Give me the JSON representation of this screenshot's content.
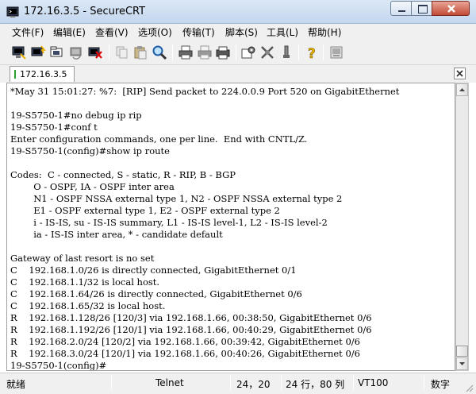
{
  "window": {
    "title": "172.16.3.5 - SecureCRT",
    "controls": [
      "minimize-icon",
      "maximize-icon",
      "close-icon"
    ]
  },
  "menu": {
    "items": [
      "文件(F)",
      "编辑(E)",
      "查看(V)",
      "选项(O)",
      "传输(T)",
      "脚本(S)",
      "工具(L)",
      "帮助(H)"
    ]
  },
  "toolbar": {
    "icons": [
      "connect-icon",
      "quick-connect-icon",
      "connect-tab-icon",
      "reconnect-icon",
      "disconnect-icon",
      "copy-icon",
      "paste-icon",
      "find-icon",
      "print-icon",
      "print-setup-icon",
      "print-screen-icon",
      "session-options-icon",
      "global-options-icon",
      "keymap-icon",
      "help-icon",
      "sftp-icon"
    ]
  },
  "tabs": [
    {
      "label": "172.16.3.5",
      "status_color": "#2ca02c"
    }
  ],
  "terminal": {
    "lines": [
      "*May 31 15:01:27: %7:  [RIP] Send packet to 224.0.0.9 Port 520 on GigabitEthernet",
      "",
      "19-S5750-1#no debug ip rip",
      "19-S5750-1#conf t",
      "Enter configuration commands, one per line.  End with CNTL/Z.",
      "19-S5750-1(config)#show ip route",
      "",
      "Codes:  C - connected, S - static, R - RIP, B - BGP",
      "        O - OSPF, IA - OSPF inter area",
      "        N1 - OSPF NSSA external type 1, N2 - OSPF NSSA external type 2",
      "        E1 - OSPF external type 1, E2 - OSPF external type 2",
      "        i - IS-IS, su - IS-IS summary, L1 - IS-IS level-1, L2 - IS-IS level-2",
      "        ia - IS-IS inter area, * - candidate default",
      "",
      "Gateway of last resort is no set",
      "C    192.168.1.0/26 is directly connected, GigabitEthernet 0/1",
      "C    192.168.1.1/32 is local host.",
      "C    192.168.1.64/26 is directly connected, GigabitEthernet 0/6",
      "C    192.168.1.65/32 is local host.",
      "R    192.168.1.128/26 [120/3] via 192.168.1.66, 00:38:50, GigabitEthernet 0/6",
      "R    192.168.1.192/26 [120/1] via 192.168.1.66, 00:40:29, GigabitEthernet 0/6",
      "R    192.168.2.0/24 [120/2] via 192.168.1.66, 00:39:42, GigabitEthernet 0/6",
      "R    192.168.3.0/24 [120/1] via 192.168.1.66, 00:40:26, GigabitEthernet 0/6",
      "19-S5750-1(config)#"
    ]
  },
  "status": {
    "ready": "就绪",
    "protocol": "Telnet",
    "cursor": "24，20",
    "size": "24 行，80 列",
    "terminal_type": "VT100",
    "num_lock": "数字"
  }
}
